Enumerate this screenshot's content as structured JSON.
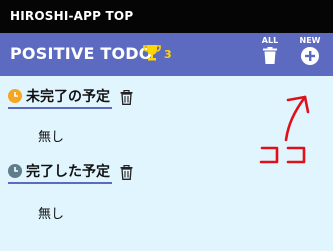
{
  "window": {
    "title": "HIROSHI-APP TOP"
  },
  "header": {
    "title": "POSITIVE TODO",
    "trophy_count": "3",
    "all_label": "ALL",
    "new_label": "NEW"
  },
  "sections": [
    {
      "title": "未完了の予定",
      "empty_text": "無し",
      "clock_color": "#f5a623"
    },
    {
      "title": "完了した予定",
      "empty_text": "無し",
      "clock_color": "#607d8b"
    }
  ],
  "annotation": {
    "text": "ココ",
    "color": "#e0101a"
  },
  "colors": {
    "header_bg": "#5c6bc0",
    "topbar_bg": "#050505",
    "body_bg": "#e1f5fe",
    "trophy": "#ffd600"
  }
}
